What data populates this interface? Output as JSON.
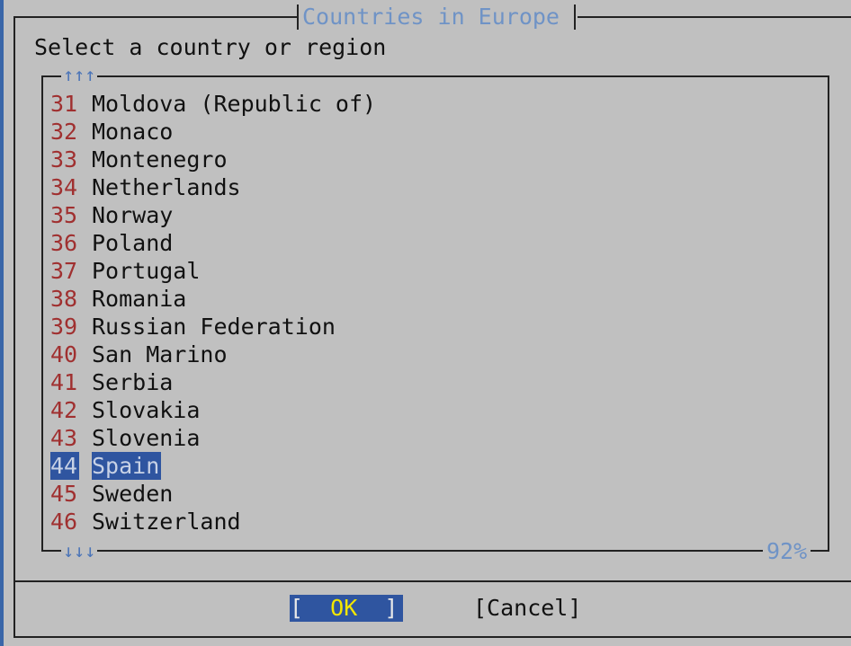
{
  "dialog": {
    "title": "Countries in Europe",
    "prompt": "Select a country or region",
    "scroll_up_indicator": "↑↑↑",
    "scroll_down_indicator": "↓↓↓",
    "scroll_percent": "92%"
  },
  "list": {
    "items": [
      {
        "number": "31",
        "name": "Moldova (Republic of)"
      },
      {
        "number": "32",
        "name": "Monaco"
      },
      {
        "number": "33",
        "name": "Montenegro"
      },
      {
        "number": "34",
        "name": "Netherlands"
      },
      {
        "number": "35",
        "name": "Norway"
      },
      {
        "number": "36",
        "name": "Poland"
      },
      {
        "number": "37",
        "name": "Portugal"
      },
      {
        "number": "38",
        "name": "Romania"
      },
      {
        "number": "39",
        "name": "Russian Federation"
      },
      {
        "number": "40",
        "name": "San Marino"
      },
      {
        "number": "41",
        "name": "Serbia"
      },
      {
        "number": "42",
        "name": "Slovakia"
      },
      {
        "number": "43",
        "name": "Slovenia"
      },
      {
        "number": "44",
        "name": "Spain"
      },
      {
        "number": "45",
        "name": "Sweden"
      },
      {
        "number": "46",
        "name": "Switzerland"
      }
    ],
    "selected_index": 13
  },
  "buttons": {
    "ok_open": "[  ",
    "ok_label": "OK",
    "ok_close": "  ]",
    "cancel_label": "[Cancel]"
  },
  "colors": {
    "background": "#3a66a8",
    "dialog": "#c0c0c0",
    "title": "#6f93c6",
    "number": "#a03030",
    "selection": "#2f55a0",
    "ok_label": "#f2e600"
  }
}
